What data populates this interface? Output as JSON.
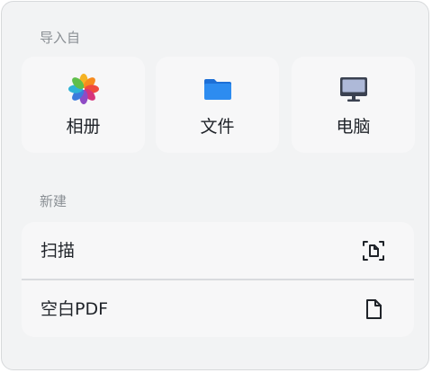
{
  "import_section": {
    "title": "导入自",
    "items": [
      {
        "label": "相册",
        "icon": "photos-icon"
      },
      {
        "label": "文件",
        "icon": "folder-icon"
      },
      {
        "label": "电脑",
        "icon": "computer-icon"
      }
    ]
  },
  "new_section": {
    "title": "新建",
    "items": [
      {
        "label": "扫描",
        "icon": "scan-document-icon"
      },
      {
        "label": "空白PDF",
        "icon": "blank-document-icon"
      }
    ]
  },
  "colors": {
    "folder_blue": "#2d8cf0",
    "monitor_dark": "#3a4150",
    "text_primary": "#1f2329",
    "text_secondary": "#8a8f94"
  }
}
